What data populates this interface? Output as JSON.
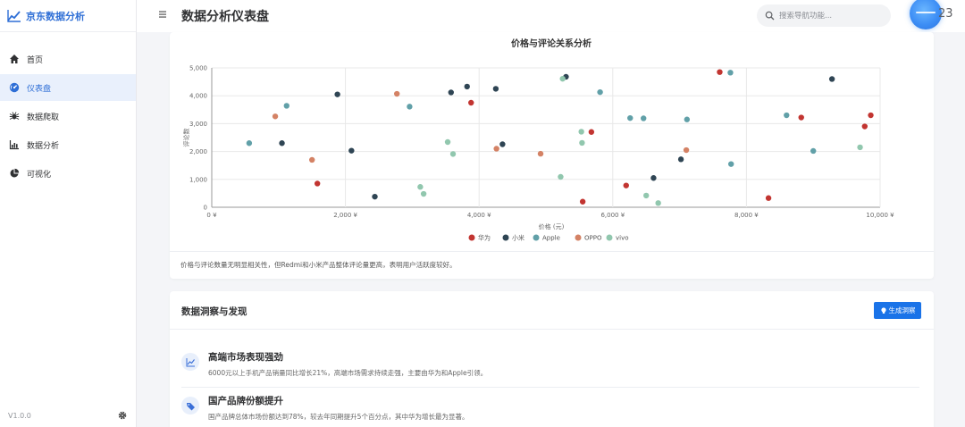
{
  "sidebar": {
    "brand": "京东数据分析",
    "items": [
      {
        "label": "首页",
        "icon": "home-icon"
      },
      {
        "label": "仪表盘",
        "icon": "dashboard-icon",
        "active": true
      },
      {
        "label": "数据爬取",
        "icon": "spider-icon"
      },
      {
        "label": "数据分析",
        "icon": "bar-chart-icon"
      },
      {
        "label": "可视化",
        "icon": "pie-chart-icon"
      }
    ],
    "version": "V1.0.0"
  },
  "header": {
    "title": "数据分析仪表盘",
    "search_placeholder": "搜索导航功能...",
    "user_text": "23"
  },
  "colors": {
    "accent": "#2f6fd6",
    "button": "#1a73e8",
    "series": [
      "#c23531",
      "#2f4554",
      "#61a0a8",
      "#d48265",
      "#91c7ae"
    ]
  },
  "chart_data": {
    "type": "scatter",
    "title": "价格与评论关系分析",
    "xlabel": "价格 (元)",
    "ylabel": "评论数",
    "xlim": [
      0,
      10000
    ],
    "ylim": [
      0,
      5000
    ],
    "xticks": [
      "0 ¥",
      "2,000 ¥",
      "4,000 ¥",
      "6,000 ¥",
      "8,000 ¥",
      "10,000 ¥"
    ],
    "yticks": [
      "0",
      "1,000",
      "2,000",
      "3,000",
      "4,000",
      "5,000"
    ],
    "legend_position": "bottom",
    "grid": true,
    "series": [
      {
        "name": "华为",
        "color": "#c23531",
        "points": [
          [
            1580,
            850
          ],
          [
            3880,
            3750
          ],
          [
            5550,
            200
          ],
          [
            5680,
            2700
          ],
          [
            6200,
            780
          ],
          [
            7600,
            4850
          ],
          [
            8330,
            330
          ],
          [
            8820,
            3220
          ],
          [
            9770,
            2900
          ],
          [
            9860,
            3300
          ]
        ]
      },
      {
        "name": "小米",
        "color": "#2f4554",
        "points": [
          [
            1050,
            2300
          ],
          [
            1880,
            4050
          ],
          [
            2090,
            2030
          ],
          [
            2440,
            380
          ],
          [
            3580,
            4120
          ],
          [
            3820,
            4330
          ],
          [
            4250,
            4250
          ],
          [
            4350,
            2260
          ],
          [
            5300,
            4680
          ],
          [
            6610,
            1050
          ],
          [
            7020,
            1720
          ],
          [
            9280,
            4600
          ]
        ]
      },
      {
        "name": "Apple",
        "color": "#61a0a8",
        "points": [
          [
            560,
            2300
          ],
          [
            1120,
            3640
          ],
          [
            2960,
            3610
          ],
          [
            5810,
            4130
          ],
          [
            6260,
            3200
          ],
          [
            6460,
            3190
          ],
          [
            7110,
            3150
          ],
          [
            7760,
            4830
          ],
          [
            7770,
            1550
          ],
          [
            8600,
            3300
          ],
          [
            9000,
            2020
          ]
        ]
      },
      {
        "name": "OPPO",
        "color": "#d48265",
        "points": [
          [
            950,
            3260
          ],
          [
            1500,
            1700
          ],
          [
            2770,
            4070
          ],
          [
            4260,
            2100
          ],
          [
            4920,
            1920
          ],
          [
            7100,
            2050
          ]
        ]
      },
      {
        "name": "vivo",
        "color": "#91c7ae",
        "points": [
          [
            3120,
            730
          ],
          [
            3170,
            480
          ],
          [
            3530,
            2340
          ],
          [
            3610,
            1910
          ],
          [
            5220,
            1090
          ],
          [
            5250,
            4610
          ],
          [
            5530,
            2710
          ],
          [
            5540,
            2310
          ],
          [
            6500,
            420
          ],
          [
            6680,
            150
          ],
          [
            9700,
            2150
          ]
        ]
      }
    ]
  },
  "chart_description": "价格与评论数量无明显相关性，但Redmi和小米产品整体评论量更高，表明用户活跃度较好。",
  "insights": {
    "title": "数据洞察与发现",
    "button_label": "生成洞察",
    "items": [
      {
        "icon": "trend-line-icon",
        "title": "高端市场表现强劲",
        "desc": "6000元以上手机产品销量同比增长21%，高端市场需求持续走强，主要由华为和Apple引领。"
      },
      {
        "icon": "tag-icon",
        "title": "国产品牌份额提升",
        "desc": "国产品牌总体市场份额达到78%，较去年同期提升5个百分点，其中华为增长最为显著。"
      }
    ]
  }
}
